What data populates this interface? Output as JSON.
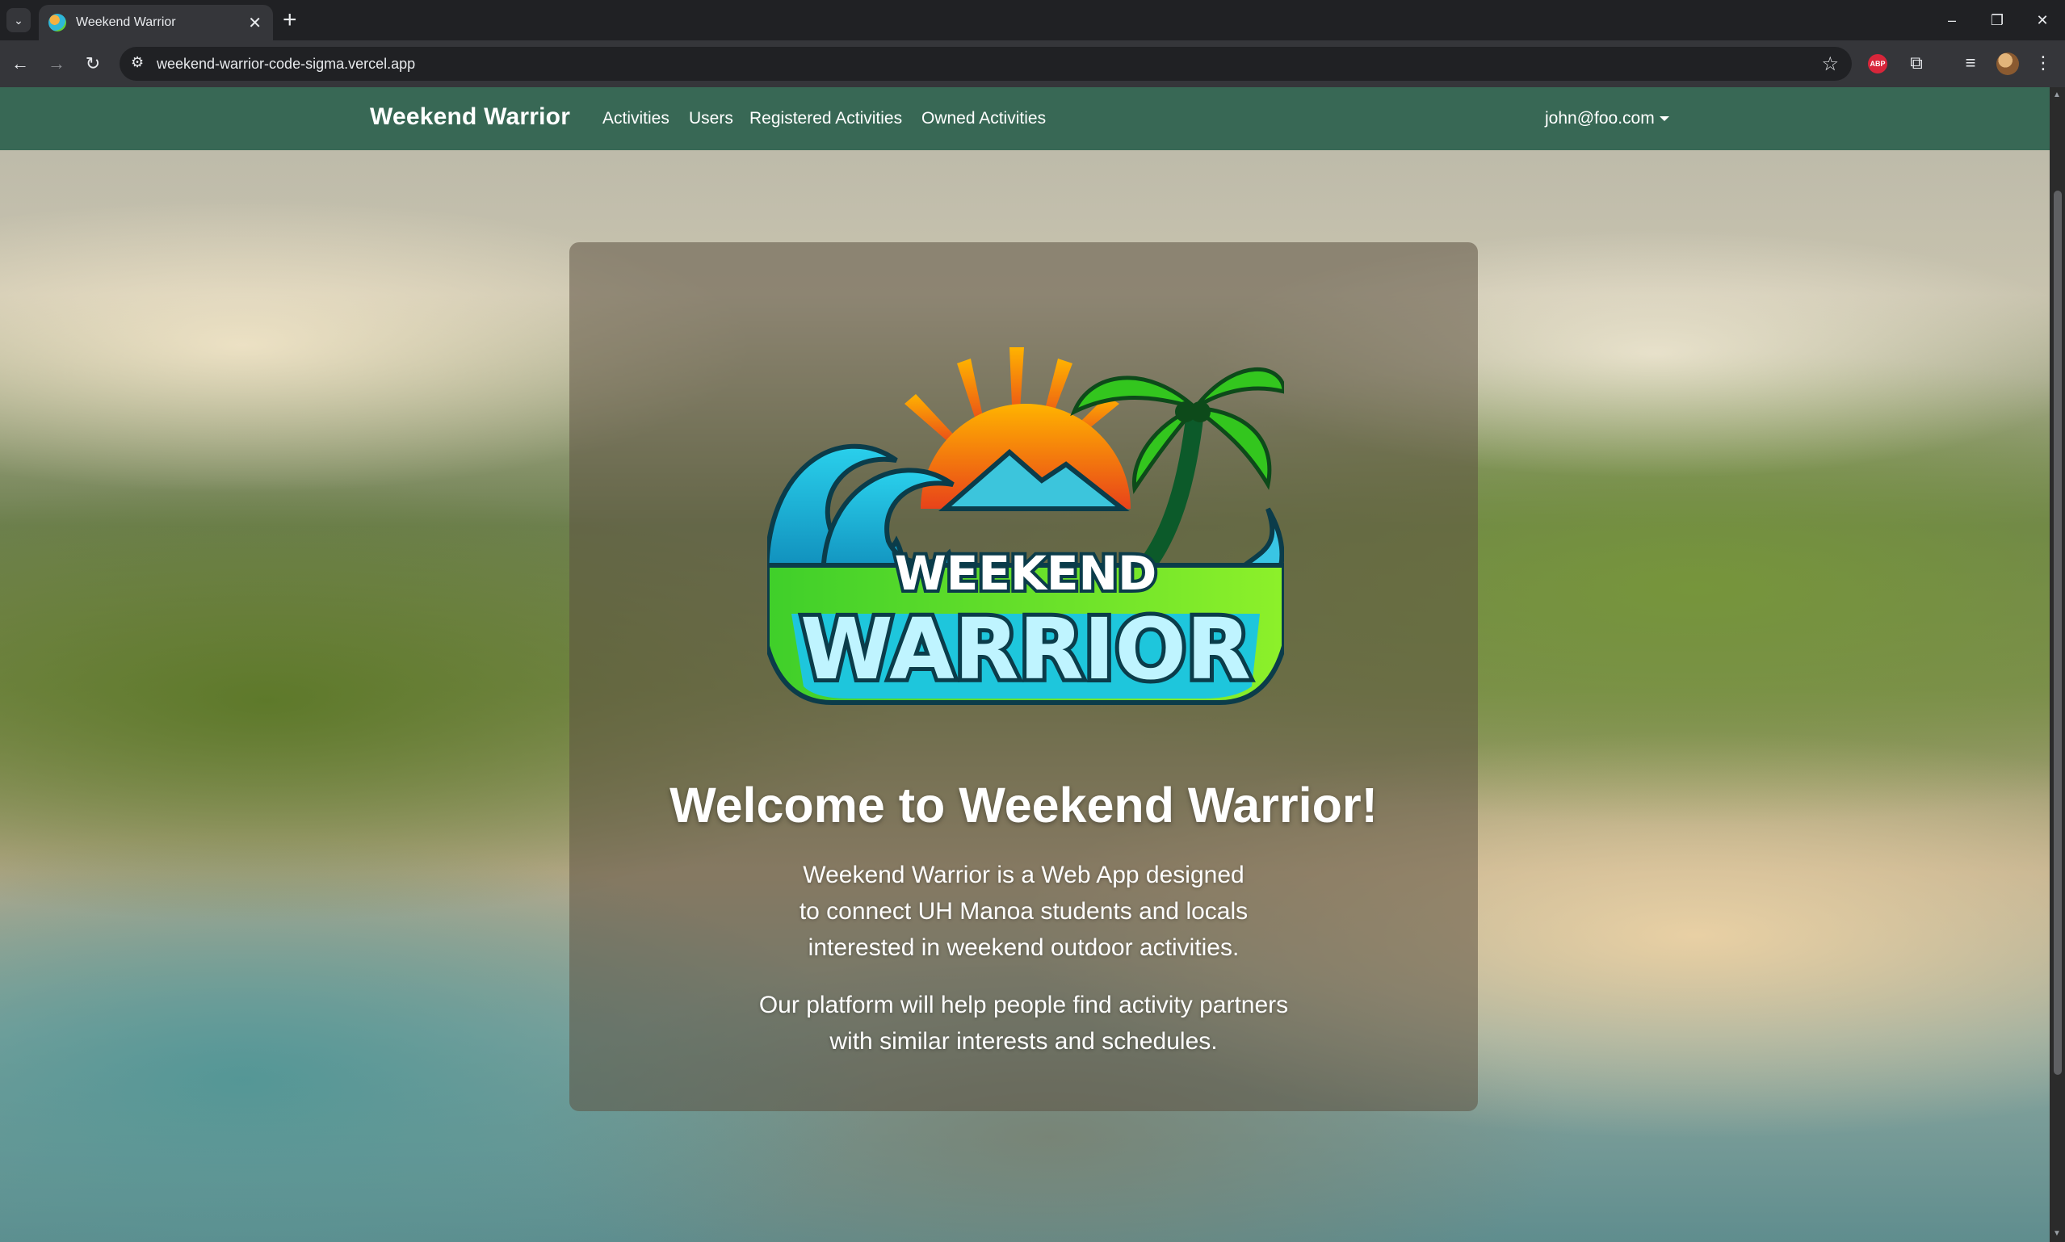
{
  "browser": {
    "tab_title": "Weekend Warrior",
    "tab_close": "✕",
    "new_tab": "+",
    "url": "weekend-warrior-code-sigma.vercel.app",
    "abp_label": "ABP",
    "window_controls": {
      "minimize": "–",
      "restore": "❐",
      "close": "✕"
    }
  },
  "navbar": {
    "brand": "Weekend Warrior",
    "links": [
      "Activities",
      "Users",
      "Registered Activities",
      "Owned Activities"
    ],
    "user": "john@foo.com",
    "color": "#386855"
  },
  "hero": {
    "logo_text": {
      "line1": "WEEKEND",
      "line2": "WARRIOR"
    },
    "title": "Welcome to Weekend Warrior!",
    "paragraph1": [
      "Weekend Warrior is a Web App designed",
      "to connect UH Manoa students and locals",
      "interested in weekend outdoor activities."
    ],
    "paragraph2": [
      "Our platform will help people find activity partners",
      "with similar interests and schedules."
    ]
  }
}
